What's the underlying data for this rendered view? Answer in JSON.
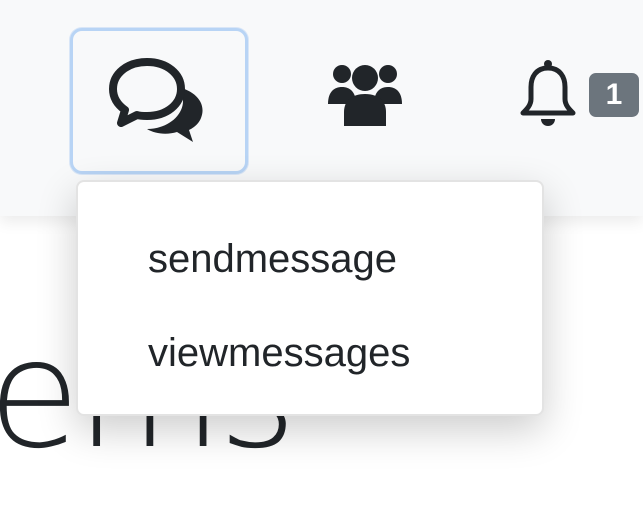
{
  "navbar": {
    "messages_icon": "comments-icon",
    "users_icon": "users-icon",
    "notifications_icon": "bell-icon",
    "notification_count": "1"
  },
  "dropdown": {
    "items": [
      {
        "label": "sendmessage"
      },
      {
        "label": "viewmessages"
      }
    ]
  },
  "background": {
    "heading_fragment": "ems"
  },
  "colors": {
    "focus_ring": "#b8d4f5",
    "badge_bg": "#6c757d",
    "navbar_bg": "#f8f9fa",
    "text": "#212529"
  }
}
